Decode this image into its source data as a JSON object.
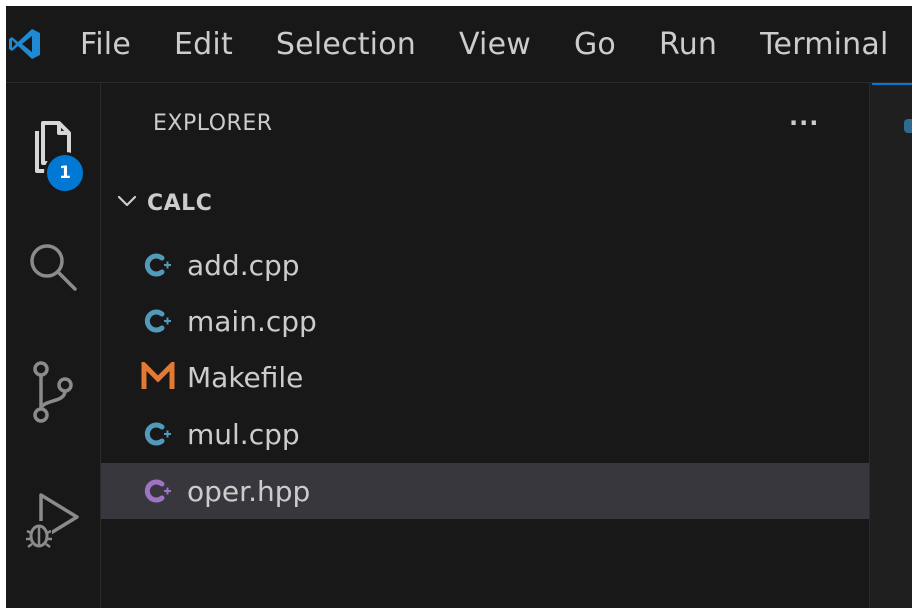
{
  "menu": {
    "items": [
      "File",
      "Edit",
      "Selection",
      "View",
      "Go",
      "Run",
      "Terminal"
    ]
  },
  "activity_bar": {
    "explorer_badge": "1",
    "icons": [
      "files-icon",
      "search-icon",
      "source-control-icon",
      "run-debug-icon"
    ]
  },
  "sidebar": {
    "title": "EXPLORER",
    "more_actions": "···",
    "folder": {
      "name": "CALC",
      "expanded": true
    },
    "files": [
      {
        "name": "add.cpp",
        "icon": "cpp-file-icon",
        "selected": false
      },
      {
        "name": "main.cpp",
        "icon": "cpp-file-icon",
        "selected": false
      },
      {
        "name": "Makefile",
        "icon": "makefile-icon",
        "selected": false
      },
      {
        "name": "mul.cpp",
        "icon": "cpp-file-icon",
        "selected": false
      },
      {
        "name": "oper.hpp",
        "icon": "hpp-file-icon",
        "selected": true
      }
    ]
  },
  "colors": {
    "accent": "#0078d4",
    "cpp_icon": "#519aba",
    "hpp_icon": "#a074c4",
    "makefile_icon": "#e37933",
    "selected_row": "#37373d"
  }
}
